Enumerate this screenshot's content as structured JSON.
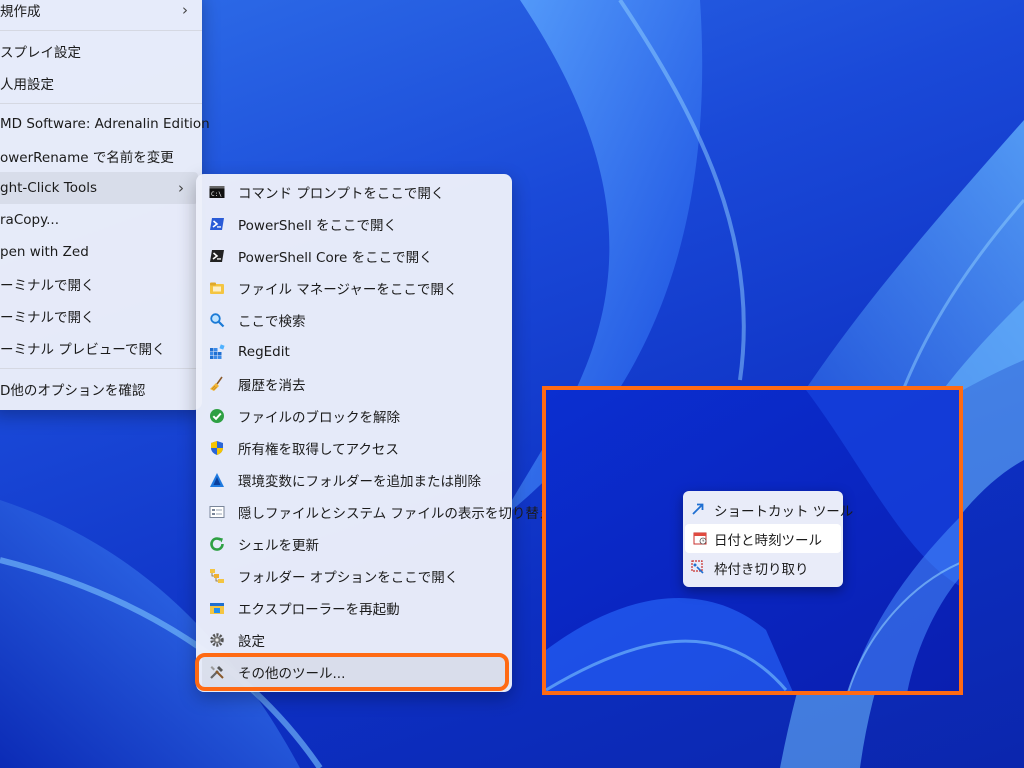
{
  "main_menu": {
    "items": [
      {
        "label": "規作成",
        "has_submenu": true
      },
      {
        "label": "スプレイ設定"
      },
      {
        "label": "人用設定"
      },
      {
        "label": "MD Software: Adrenalin Edition"
      },
      {
        "label": "owerRename で名前を変更"
      },
      {
        "label": "ght-Click Tools",
        "has_submenu": true
      },
      {
        "label": "raCopy..."
      },
      {
        "label": "pen with Zed"
      },
      {
        "label": "ーミナルで開く"
      },
      {
        "label": "ーミナルで開く"
      },
      {
        "label": "ーミナル プレビューで開く"
      },
      {
        "label": "D他のオプションを確認"
      }
    ]
  },
  "submenu": {
    "items": [
      {
        "label": "コマンド プロンプトをここで開く",
        "icon": "cmd-icon"
      },
      {
        "label": "PowerShell をここで開く",
        "icon": "powershell-icon"
      },
      {
        "label": "PowerShell Core をここで開く",
        "icon": "powershell-core-icon"
      },
      {
        "label": "ファイル マネージャーをここで開く",
        "icon": "file-manager-icon"
      },
      {
        "label": "ここで検索",
        "icon": "search-icon"
      },
      {
        "label": "RegEdit",
        "icon": "regedit-icon"
      },
      {
        "label": "履歴を消去",
        "icon": "broom-icon"
      },
      {
        "label": "ファイルのブロックを解除",
        "icon": "check-icon"
      },
      {
        "label": "所有権を取得してアクセス",
        "icon": "shield-icon"
      },
      {
        "label": "環境変数にフォルダーを追加または削除",
        "icon": "env-var-icon"
      },
      {
        "label": "隠しファイルとシステム ファイルの表示を切り替え",
        "icon": "hidden-files-icon"
      },
      {
        "label": "シェルを更新",
        "icon": "refresh-icon"
      },
      {
        "label": "フォルダー オプションをここで開く",
        "icon": "folder-options-icon"
      },
      {
        "label": "エクスプローラーを再起動",
        "icon": "explorer-restart-icon"
      },
      {
        "label": "設定",
        "icon": "gear-icon"
      },
      {
        "label": "その他のツール...",
        "icon": "tools-icon"
      }
    ]
  },
  "tools_menu": {
    "items": [
      {
        "label": "ショートカット ツール",
        "icon": "shortcut-arrow-icon"
      },
      {
        "label": "日付と時刻ツール",
        "icon": "calendar-icon"
      },
      {
        "label": "枠付き切り取り",
        "icon": "crop-icon"
      }
    ]
  },
  "colors": {
    "highlight_outline": "#ff6a13",
    "wallpaper_blue": "#1a49d8"
  }
}
